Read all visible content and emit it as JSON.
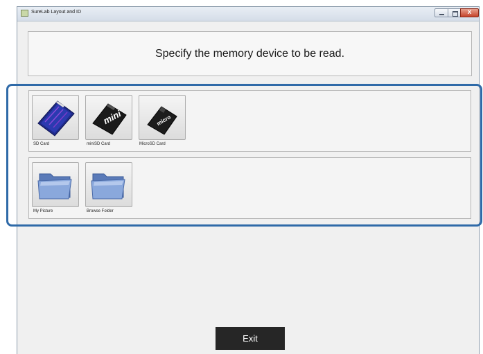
{
  "window": {
    "title": "SureLab Layout and ID",
    "close_glyph": "x"
  },
  "prompt": "Specify the memory device to be read.",
  "devices": [
    {
      "label": "SD Card",
      "icon": "sd-card-icon"
    },
    {
      "label": "miniSD Card",
      "icon": "minisd-card-icon",
      "icon_text": "mini"
    },
    {
      "label": "MicroSD Card",
      "icon": "microsd-card-icon",
      "icon_text": "micro"
    }
  ],
  "folders": [
    {
      "label": "My Picture",
      "icon": "folder-icon"
    },
    {
      "label": "Browse Folder",
      "icon": "folder-icon"
    }
  ],
  "exit_label": "Exit",
  "colors": {
    "highlight": "#2f6aa8",
    "exit_bg": "#262626",
    "sd_card": "#1f2a8a"
  }
}
